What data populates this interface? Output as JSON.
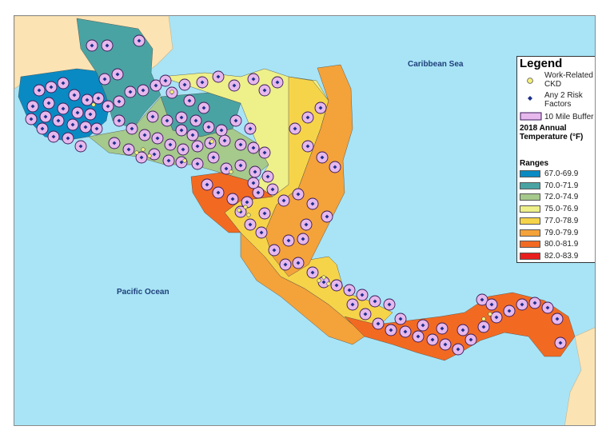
{
  "map": {
    "labels": {
      "caribbean": "Caribbean Sea",
      "pacific": "Pacific Ocean"
    },
    "colors": {
      "ocean": "#a8e4f6",
      "land_other": "#fbe3b4",
      "buffer_fill": "#e6b8ec",
      "buffer_stroke": "#3a1a5a",
      "risk_dot": "#1c2f8c",
      "ckd_fill": "#f4f07a"
    },
    "icons": {
      "ckd": "yellow-circle-icon",
      "risk": "blue-diamond-icon",
      "buffer": "pink-rectangle-icon"
    }
  },
  "legend": {
    "title": "Legend",
    "ckd_label": "Work-Related CKD",
    "risk_label": "Any 2 Risk Factors",
    "buffer_label": "10 Mile Buffer",
    "temp_heading": "2018 Annual Temperature (°F)",
    "ranges_heading": "Ranges",
    "ranges": [
      {
        "label": "67.0-69.9",
        "color": "#0a8ac2"
      },
      {
        "label": "70.0-71.9",
        "color": "#4aa3a3"
      },
      {
        "label": "72.0-74.9",
        "color": "#a6c98c"
      },
      {
        "label": "75.0-76.9",
        "color": "#eef08a"
      },
      {
        "label": "77.0-78.9",
        "color": "#f6d44a"
      },
      {
        "label": "79.0-79.9",
        "color": "#f4a23a"
      },
      {
        "label": "80.0-81.9",
        "color": "#f26a22"
      },
      {
        "label": "82.0-83.9",
        "color": "#e81e1e"
      }
    ]
  }
}
